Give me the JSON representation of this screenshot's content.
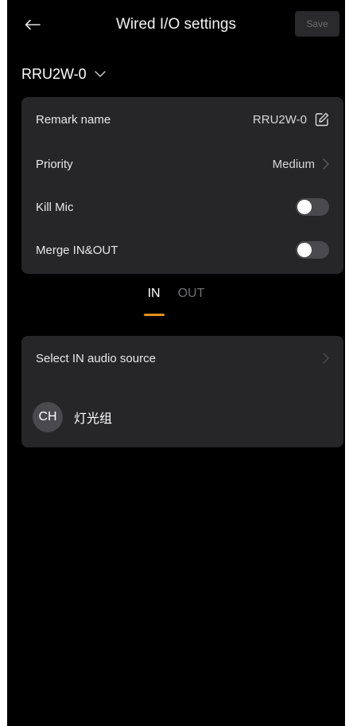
{
  "header": {
    "title": "Wired I/O settings",
    "save_label": "Save"
  },
  "device": {
    "name": "RRU2W-0"
  },
  "settings": {
    "remark_label": "Remark name",
    "remark_value": "RRU2W-0",
    "priority_label": "Priority",
    "priority_value": "Medium",
    "kill_mic_label": "Kill Mic",
    "kill_mic_on": false,
    "merge_label": "Merge IN&OUT",
    "merge_on": false
  },
  "tabs": {
    "in_label": "IN",
    "out_label": "OUT",
    "active": "IN"
  },
  "source": {
    "select_label": "Select IN audio source",
    "channel_avatar": "CH",
    "channel_name": "灯光组"
  },
  "colors": {
    "background": "#000000",
    "card": "#262629",
    "accent": "#e8901a",
    "toggle_off": "#4a4a4e"
  },
  "icons": {
    "back": "back-arrow-icon",
    "dropdown": "chevron-down-icon",
    "edit": "edit-icon",
    "chevron": "chevron-right-icon"
  }
}
